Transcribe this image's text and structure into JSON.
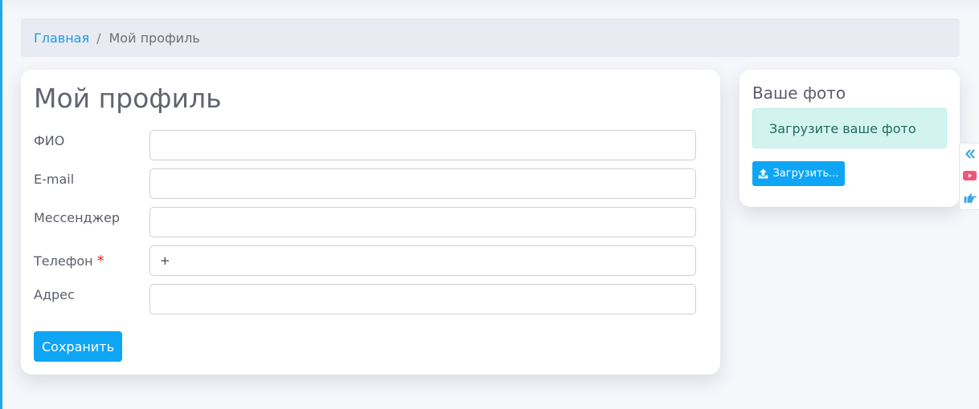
{
  "breadcrumb": {
    "home_label": "Главная",
    "separator": "/",
    "current_label": "Мой профиль"
  },
  "profile": {
    "title": "Мой профиль",
    "fields": [
      {
        "label": "ФИО",
        "value": "",
        "required": false
      },
      {
        "label": "E-mail",
        "value": "",
        "required": false
      },
      {
        "label": "Мессенджер",
        "value": "",
        "required": false
      },
      {
        "label": "Телефон",
        "value": "+",
        "required": true,
        "required_mark": "*"
      },
      {
        "label": "Адрес",
        "value": "",
        "required": false
      }
    ],
    "save_label": "Сохранить"
  },
  "photo": {
    "title": "Ваше фото",
    "alert_text": "Загрузите ваше фото",
    "upload_label": "Загрузить..."
  },
  "side_tools": [
    {
      "icon": "double-chevron-left-icon"
    },
    {
      "icon": "youtube-icon"
    },
    {
      "icon": "pointing-hand-icon"
    }
  ],
  "colors": {
    "accent": "#0ea5f5",
    "link": "#1e9be0",
    "required": "#e02424",
    "alert_bg": "#d3f4ee",
    "youtube": "#f0557a"
  }
}
